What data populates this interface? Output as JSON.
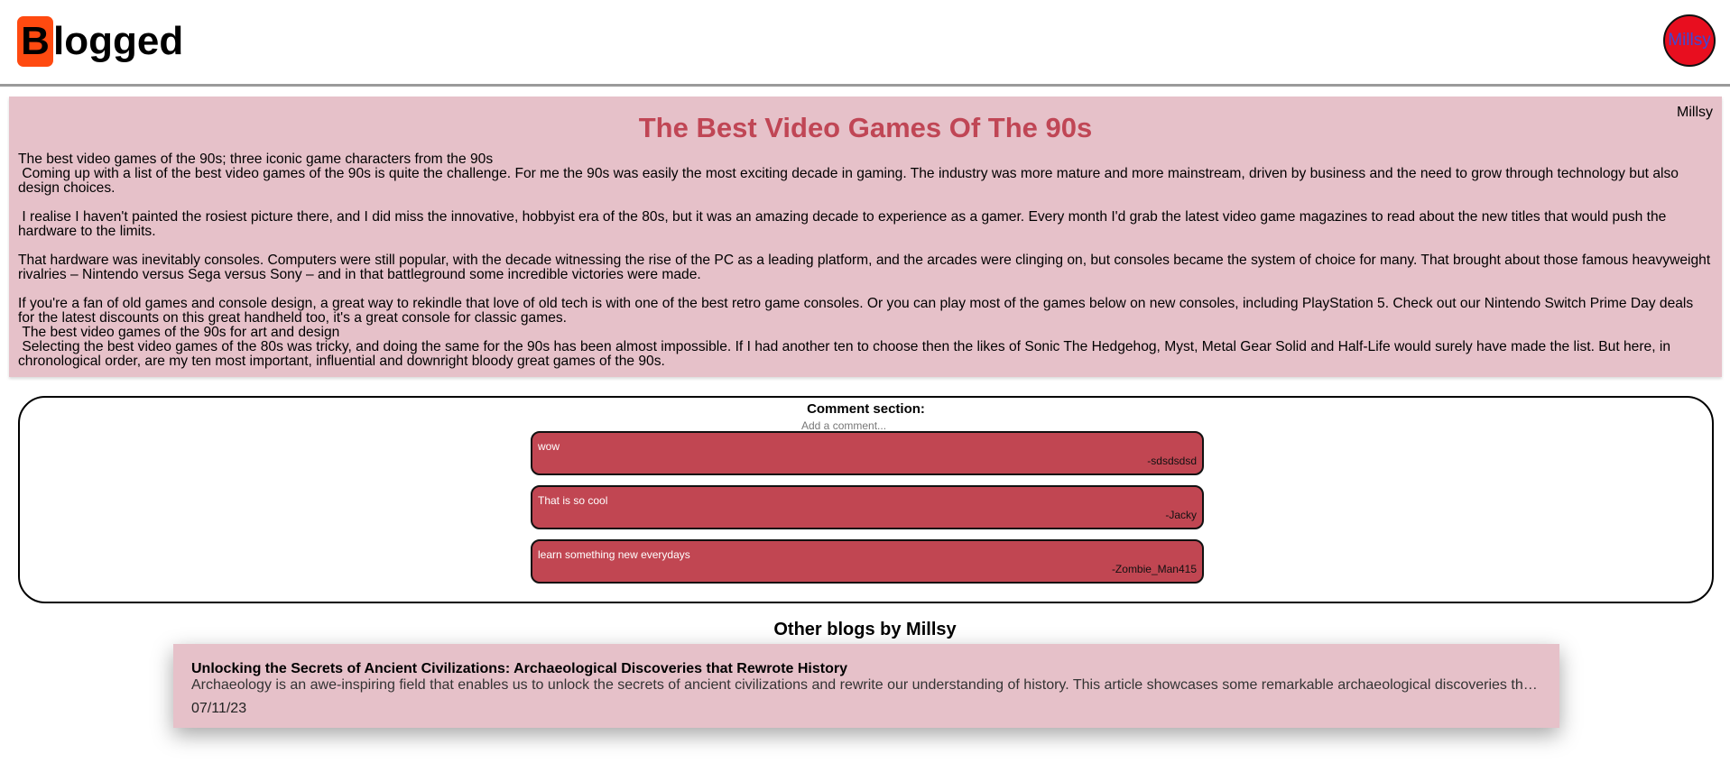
{
  "header": {
    "logo_letter": "B",
    "logo_rest": "logged",
    "avatar_label": "Millsy"
  },
  "article": {
    "author": "Millsy",
    "title": "The Best Video Games Of The 90s",
    "body": "The best video games of the 90s; three iconic game characters from the 90s\n Coming up with a list of the best video games of the 90s is quite the challenge. For me the 90s was easily the most exciting decade in gaming. The industry was more mature and more mainstream, driven by business and the need to grow through technology but also design choices.\n\n I realise I haven't painted the rosiest picture there, and I did miss the innovative, hobbyist era of the 80s, but it was an amazing decade to experience as a gamer. Every month I'd grab the latest video game magazines to read about the new titles that would push the hardware to the limits.\n\nThat hardware was inevitably consoles. Computers were still popular, with the decade witnessing the rise of the PC as a leading platform, and the arcades were clinging on, but consoles became the system of choice for many. That brought about those famous heavyweight rivalries – Nintendo versus Sega versus Sony – and in that battleground some incredible victories were made.\n\nIf you're a fan of old games and console design, a great way to rekindle that love of old tech is with one of the best retro game consoles. Or you can play most of the games below on new consoles, including PlayStation 5. Check out our Nintendo Switch Prime Day deals for the latest discounts on this great handheld too, it's a great console for classic games.\n The best video games of the 90s for art and design\n Selecting the best video games of the 80s was tricky, and doing the same for the 90s has been almost impossible. If I had another ten to choose then the likes of Sonic The Hedgehog, Myst, Metal Gear Solid and Half-Life would surely have made the list. But here, in chronological order, are my ten most important, influential and downright bloody great games of the 90s."
  },
  "comments": {
    "heading": "Comment section:",
    "input_placeholder": "Add a comment...",
    "items": [
      {
        "text": "wow",
        "user": "-sdsdsdsd"
      },
      {
        "text": "That is so cool",
        "user": "-Jacky"
      },
      {
        "text": "learn something new everydays",
        "user": "-Zombie_Man415"
      }
    ]
  },
  "other_blogs": {
    "heading": "Other blogs by Millsy",
    "items": [
      {
        "title": "Unlocking the Secrets of Ancient Civilizations: Archaeological Discoveries that Rewrote History",
        "excerpt": "Archaeology is an awe-inspiring field that enables us to unlock the secrets of ancient civilizations and rewrite our understanding of history. This article showcases some remarkable archaeological discoveries that have challenged our assumptions and shed new light on the past.",
        "date": "07/11/23"
      }
    ]
  },
  "colors": {
    "logo_accent": "#ff4a10",
    "avatar_bg": "#e80e1f",
    "article_bg": "#e6c1c9",
    "title_color": "#c04655",
    "comment_bg": "#c14652"
  }
}
